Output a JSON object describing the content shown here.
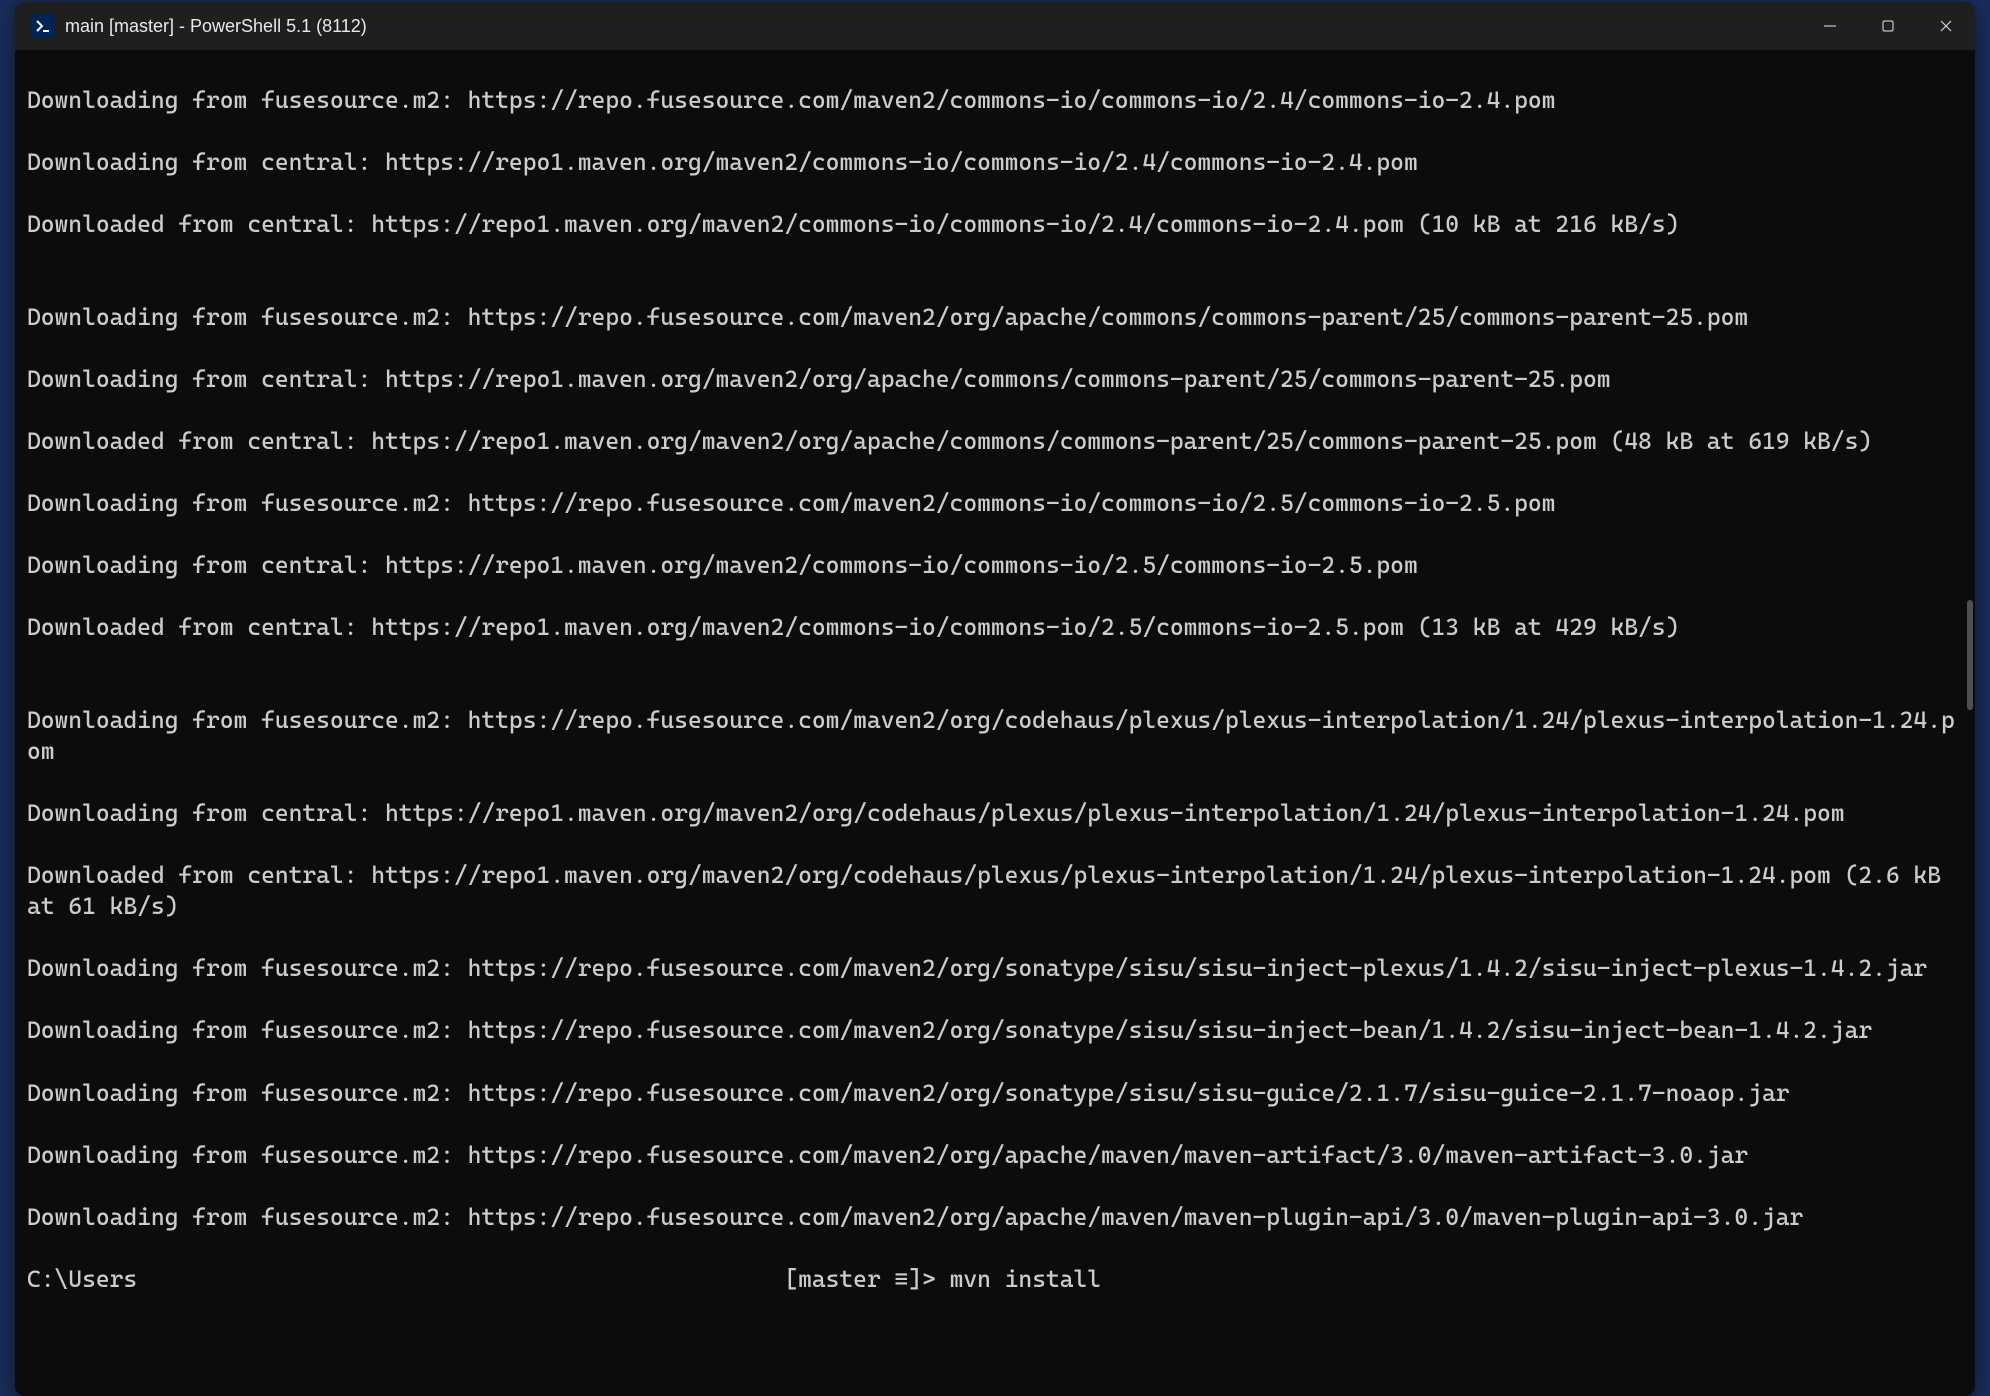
{
  "titlebar": {
    "title": "main [master] - PowerShell 5.1 (8112)"
  },
  "terminal": {
    "lines": [
      "Downloading from fusesource.m2: https://repo.fusesource.com/maven2/commons-io/commons-io/2.4/commons-io-2.4.pom",
      "Downloading from central: https://repo1.maven.org/maven2/commons-io/commons-io/2.4/commons-io-2.4.pom",
      "Downloaded from central: https://repo1.maven.org/maven2/commons-io/commons-io/2.4/commons-io-2.4.pom (10 kB at 216 kB/s)",
      "",
      "Downloading from fusesource.m2: https://repo.fusesource.com/maven2/org/apache/commons/commons-parent/25/commons-parent-25.pom",
      "Downloading from central: https://repo1.maven.org/maven2/org/apache/commons/commons-parent/25/commons-parent-25.pom",
      "Downloaded from central: https://repo1.maven.org/maven2/org/apache/commons/commons-parent/25/commons-parent-25.pom (48 kB at 619 kB/s)",
      "Downloading from fusesource.m2: https://repo.fusesource.com/maven2/commons-io/commons-io/2.5/commons-io-2.5.pom",
      "Downloading from central: https://repo1.maven.org/maven2/commons-io/commons-io/2.5/commons-io-2.5.pom",
      "Downloaded from central: https://repo1.maven.org/maven2/commons-io/commons-io/2.5/commons-io-2.5.pom (13 kB at 429 kB/s)",
      "",
      "Downloading from fusesource.m2: https://repo.fusesource.com/maven2/org/codehaus/plexus/plexus-interpolation/1.24/plexus-interpolation-1.24.pom",
      "Downloading from central: https://repo1.maven.org/maven2/org/codehaus/plexus/plexus-interpolation/1.24/plexus-interpolation-1.24.pom",
      "Downloaded from central: https://repo1.maven.org/maven2/org/codehaus/plexus/plexus-interpolation/1.24/plexus-interpolation-1.24.pom (2.6 kB at 61 kB/s)",
      "Downloading from fusesource.m2: https://repo.fusesource.com/maven2/org/sonatype/sisu/sisu-inject-plexus/1.4.2/sisu-inject-plexus-1.4.2.jar",
      "Downloading from fusesource.m2: https://repo.fusesource.com/maven2/org/sonatype/sisu/sisu-inject-bean/1.4.2/sisu-inject-bean-1.4.2.jar",
      "Downloading from fusesource.m2: https://repo.fusesource.com/maven2/org/sonatype/sisu/sisu-guice/2.1.7/sisu-guice-2.1.7-noaop.jar",
      "Downloading from fusesource.m2: https://repo.fusesource.com/maven2/org/apache/maven/maven-artifact/3.0/maven-artifact-3.0.jar",
      "Downloading from fusesource.m2: https://repo.fusesource.com/maven2/org/apache/maven/maven-plugin-api/3.0/maven-plugin-api-3.0.jar"
    ],
    "prompt": {
      "path": "C:\\Users",
      "branch_indicator": "[master ≡]>",
      "command": "mvn install"
    }
  }
}
